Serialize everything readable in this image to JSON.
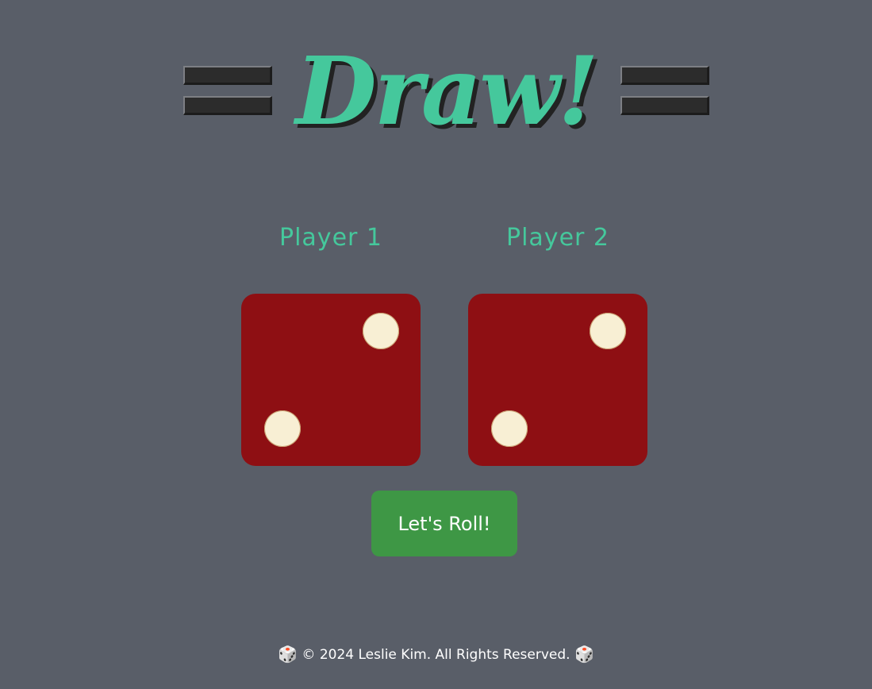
{
  "header": {
    "title": "Draw!",
    "flag_icon": "flag-icon"
  },
  "players": [
    {
      "label": "Player 1",
      "die_value": 2
    },
    {
      "label": "Player 2",
      "die_value": 2
    }
  ],
  "roll_button": {
    "label": "Let's Roll!"
  },
  "footer": {
    "text": "© 2024 Leslie Kim. All Rights Reserved.",
    "icon_glyph": "🎲",
    "icon_name": "dice-icon"
  },
  "colors": {
    "background": "#595e68",
    "accent": "#45c89c",
    "die": "#8e0f13",
    "pip": "#f8efd4",
    "button": "#3e9745"
  }
}
